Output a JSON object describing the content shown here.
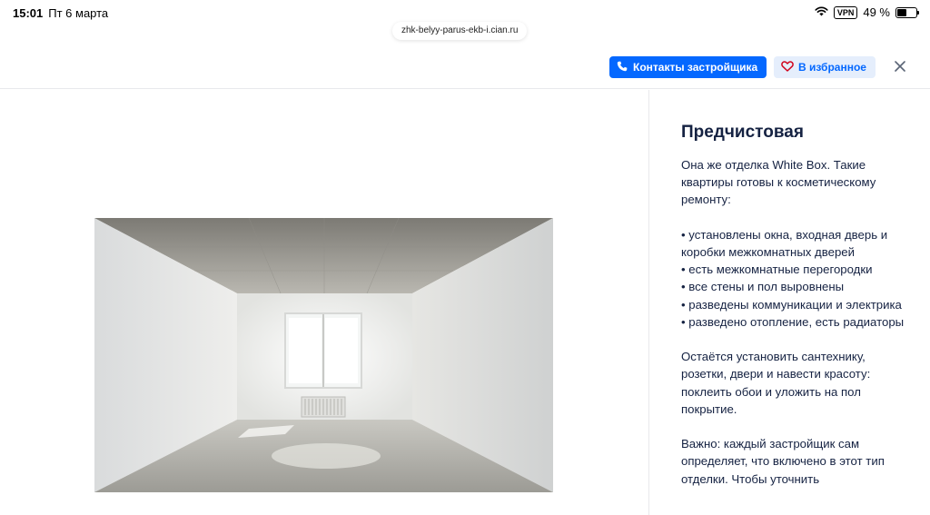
{
  "status_bar": {
    "time": "15:01",
    "date": "Пт 6 марта",
    "vpn": "VPN",
    "battery": "49 %",
    "battery_level": 0.49
  },
  "browser": {
    "url": "zhk-belyy-parus-ekb-i.cian.ru"
  },
  "toolbar": {
    "contacts_label": "Контакты застройщика",
    "favorite_label": "В избранное",
    "accent_color": "#0468ff"
  },
  "side_panel": {
    "title": "Предчистовая",
    "intro": "Она же отделка White Box. Такие квартиры готовы к косметическому ремонту:",
    "bullets": [
      "• установлены окна, входная дверь и коробки межкомнатных дверей",
      "• есть межкомнатные перегородки",
      "• все стены и пол выровнены",
      "• разведены коммуникации и электрика",
      "• разведено отопление, есть радиаторы"
    ],
    "paragraph_2": "Остаётся установить сантехнику, розетки, двери и навести красоту: поклеить обои и уложить на пол покрытие.",
    "paragraph_3": "Важно: каждый застройщик сам определяет, что включено в этот тип отделки. Чтобы уточнить"
  }
}
